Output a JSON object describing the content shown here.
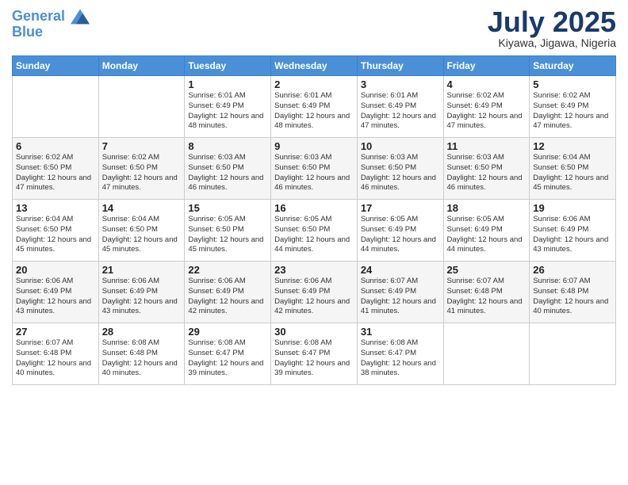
{
  "logo": {
    "line1": "General",
    "line2": "Blue"
  },
  "header": {
    "month": "July 2025",
    "location": "Kiyawa, Jigawa, Nigeria"
  },
  "days_of_week": [
    "Sunday",
    "Monday",
    "Tuesday",
    "Wednesday",
    "Thursday",
    "Friday",
    "Saturday"
  ],
  "weeks": [
    [
      {
        "day": "",
        "sunrise": "",
        "sunset": "",
        "daylight": ""
      },
      {
        "day": "",
        "sunrise": "",
        "sunset": "",
        "daylight": ""
      },
      {
        "day": "1",
        "sunrise": "Sunrise: 6:01 AM",
        "sunset": "Sunset: 6:49 PM",
        "daylight": "Daylight: 12 hours and 48 minutes."
      },
      {
        "day": "2",
        "sunrise": "Sunrise: 6:01 AM",
        "sunset": "Sunset: 6:49 PM",
        "daylight": "Daylight: 12 hours and 48 minutes."
      },
      {
        "day": "3",
        "sunrise": "Sunrise: 6:01 AM",
        "sunset": "Sunset: 6:49 PM",
        "daylight": "Daylight: 12 hours and 47 minutes."
      },
      {
        "day": "4",
        "sunrise": "Sunrise: 6:02 AM",
        "sunset": "Sunset: 6:49 PM",
        "daylight": "Daylight: 12 hours and 47 minutes."
      },
      {
        "day": "5",
        "sunrise": "Sunrise: 6:02 AM",
        "sunset": "Sunset: 6:49 PM",
        "daylight": "Daylight: 12 hours and 47 minutes."
      }
    ],
    [
      {
        "day": "6",
        "sunrise": "Sunrise: 6:02 AM",
        "sunset": "Sunset: 6:50 PM",
        "daylight": "Daylight: 12 hours and 47 minutes."
      },
      {
        "day": "7",
        "sunrise": "Sunrise: 6:02 AM",
        "sunset": "Sunset: 6:50 PM",
        "daylight": "Daylight: 12 hours and 47 minutes."
      },
      {
        "day": "8",
        "sunrise": "Sunrise: 6:03 AM",
        "sunset": "Sunset: 6:50 PM",
        "daylight": "Daylight: 12 hours and 46 minutes."
      },
      {
        "day": "9",
        "sunrise": "Sunrise: 6:03 AM",
        "sunset": "Sunset: 6:50 PM",
        "daylight": "Daylight: 12 hours and 46 minutes."
      },
      {
        "day": "10",
        "sunrise": "Sunrise: 6:03 AM",
        "sunset": "Sunset: 6:50 PM",
        "daylight": "Daylight: 12 hours and 46 minutes."
      },
      {
        "day": "11",
        "sunrise": "Sunrise: 6:03 AM",
        "sunset": "Sunset: 6:50 PM",
        "daylight": "Daylight: 12 hours and 46 minutes."
      },
      {
        "day": "12",
        "sunrise": "Sunrise: 6:04 AM",
        "sunset": "Sunset: 6:50 PM",
        "daylight": "Daylight: 12 hours and 45 minutes."
      }
    ],
    [
      {
        "day": "13",
        "sunrise": "Sunrise: 6:04 AM",
        "sunset": "Sunset: 6:50 PM",
        "daylight": "Daylight: 12 hours and 45 minutes."
      },
      {
        "day": "14",
        "sunrise": "Sunrise: 6:04 AM",
        "sunset": "Sunset: 6:50 PM",
        "daylight": "Daylight: 12 hours and 45 minutes."
      },
      {
        "day": "15",
        "sunrise": "Sunrise: 6:05 AM",
        "sunset": "Sunset: 6:50 PM",
        "daylight": "Daylight: 12 hours and 45 minutes."
      },
      {
        "day": "16",
        "sunrise": "Sunrise: 6:05 AM",
        "sunset": "Sunset: 6:50 PM",
        "daylight": "Daylight: 12 hours and 44 minutes."
      },
      {
        "day": "17",
        "sunrise": "Sunrise: 6:05 AM",
        "sunset": "Sunset: 6:49 PM",
        "daylight": "Daylight: 12 hours and 44 minutes."
      },
      {
        "day": "18",
        "sunrise": "Sunrise: 6:05 AM",
        "sunset": "Sunset: 6:49 PM",
        "daylight": "Daylight: 12 hours and 44 minutes."
      },
      {
        "day": "19",
        "sunrise": "Sunrise: 6:06 AM",
        "sunset": "Sunset: 6:49 PM",
        "daylight": "Daylight: 12 hours and 43 minutes."
      }
    ],
    [
      {
        "day": "20",
        "sunrise": "Sunrise: 6:06 AM",
        "sunset": "Sunset: 6:49 PM",
        "daylight": "Daylight: 12 hours and 43 minutes."
      },
      {
        "day": "21",
        "sunrise": "Sunrise: 6:06 AM",
        "sunset": "Sunset: 6:49 PM",
        "daylight": "Daylight: 12 hours and 43 minutes."
      },
      {
        "day": "22",
        "sunrise": "Sunrise: 6:06 AM",
        "sunset": "Sunset: 6:49 PM",
        "daylight": "Daylight: 12 hours and 42 minutes."
      },
      {
        "day": "23",
        "sunrise": "Sunrise: 6:06 AM",
        "sunset": "Sunset: 6:49 PM",
        "daylight": "Daylight: 12 hours and 42 minutes."
      },
      {
        "day": "24",
        "sunrise": "Sunrise: 6:07 AM",
        "sunset": "Sunset: 6:49 PM",
        "daylight": "Daylight: 12 hours and 41 minutes."
      },
      {
        "day": "25",
        "sunrise": "Sunrise: 6:07 AM",
        "sunset": "Sunset: 6:48 PM",
        "daylight": "Daylight: 12 hours and 41 minutes."
      },
      {
        "day": "26",
        "sunrise": "Sunrise: 6:07 AM",
        "sunset": "Sunset: 6:48 PM",
        "daylight": "Daylight: 12 hours and 40 minutes."
      }
    ],
    [
      {
        "day": "27",
        "sunrise": "Sunrise: 6:07 AM",
        "sunset": "Sunset: 6:48 PM",
        "daylight": "Daylight: 12 hours and 40 minutes."
      },
      {
        "day": "28",
        "sunrise": "Sunrise: 6:08 AM",
        "sunset": "Sunset: 6:48 PM",
        "daylight": "Daylight: 12 hours and 40 minutes."
      },
      {
        "day": "29",
        "sunrise": "Sunrise: 6:08 AM",
        "sunset": "Sunset: 6:47 PM",
        "daylight": "Daylight: 12 hours and 39 minutes."
      },
      {
        "day": "30",
        "sunrise": "Sunrise: 6:08 AM",
        "sunset": "Sunset: 6:47 PM",
        "daylight": "Daylight: 12 hours and 39 minutes."
      },
      {
        "day": "31",
        "sunrise": "Sunrise: 6:08 AM",
        "sunset": "Sunset: 6:47 PM",
        "daylight": "Daylight: 12 hours and 38 minutes."
      },
      {
        "day": "",
        "sunrise": "",
        "sunset": "",
        "daylight": ""
      },
      {
        "day": "",
        "sunrise": "",
        "sunset": "",
        "daylight": ""
      }
    ]
  ]
}
